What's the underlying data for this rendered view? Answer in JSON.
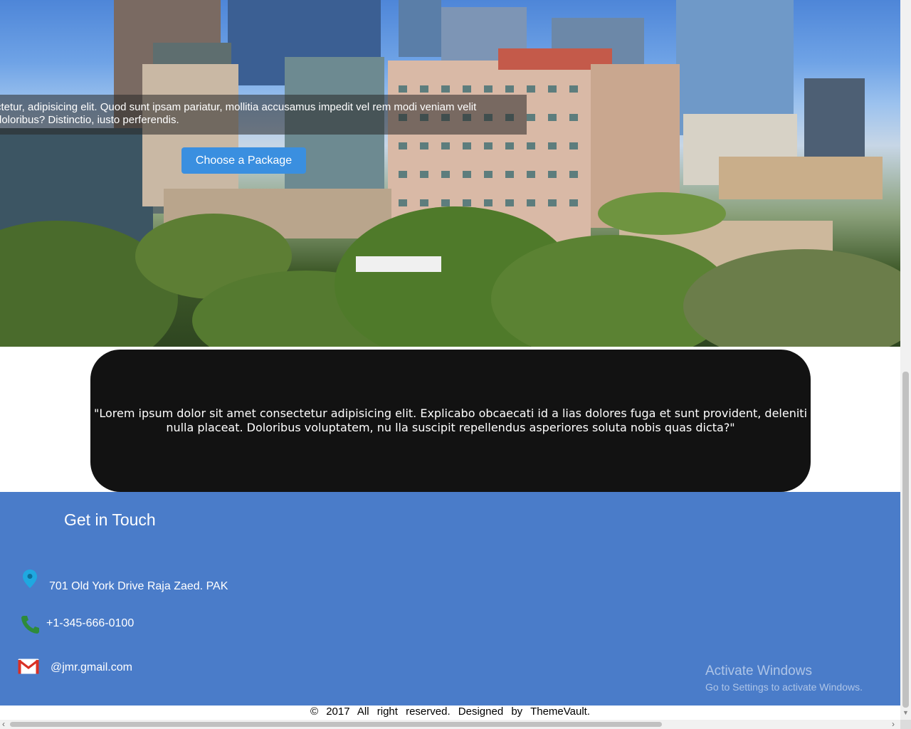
{
  "hero": {
    "text_line1": "ctetur, adipisicing elit. Quod sunt ipsam pariatur, mollitia accusamus impedit vel rem modi veniam velit",
    "text_line2": "doloribus? Distinctio, iusto perferendis.",
    "button_label": "Choose a Package"
  },
  "quote": {
    "text": "\"Lorem ipsum dolor sit amet consectetur adipisicing elit. Explicabo obcaecati id a lias dolores fuga et sunt provident, deleniti nulla placeat. Doloribus voluptatem, nu lla suscipit repellendus asperiores soluta nobis quas dicta?\""
  },
  "contact": {
    "title": "Get in Touch",
    "address": "701 Old York Drive Raja Zaed. PAK",
    "phone": "+1-345-666-0100",
    "email": "@jmr.gmail.com",
    "icons": {
      "address": "map-pin-icon",
      "phone": "phone-icon",
      "email": "gmail-icon"
    }
  },
  "watermark": {
    "title": "Activate Windows",
    "subtitle": "Go to Settings to activate Windows."
  },
  "footer": {
    "text": "© 2017 All right reserved. Designed by ThemeVault."
  },
  "colors": {
    "contact_bg": "#4a7cc9",
    "quote_bg": "#121212",
    "button_bg": "#3a8fe0",
    "pin_color": "#1fa8e0",
    "phone_color": "#2e8b3a",
    "gmail_red": "#d93025"
  }
}
